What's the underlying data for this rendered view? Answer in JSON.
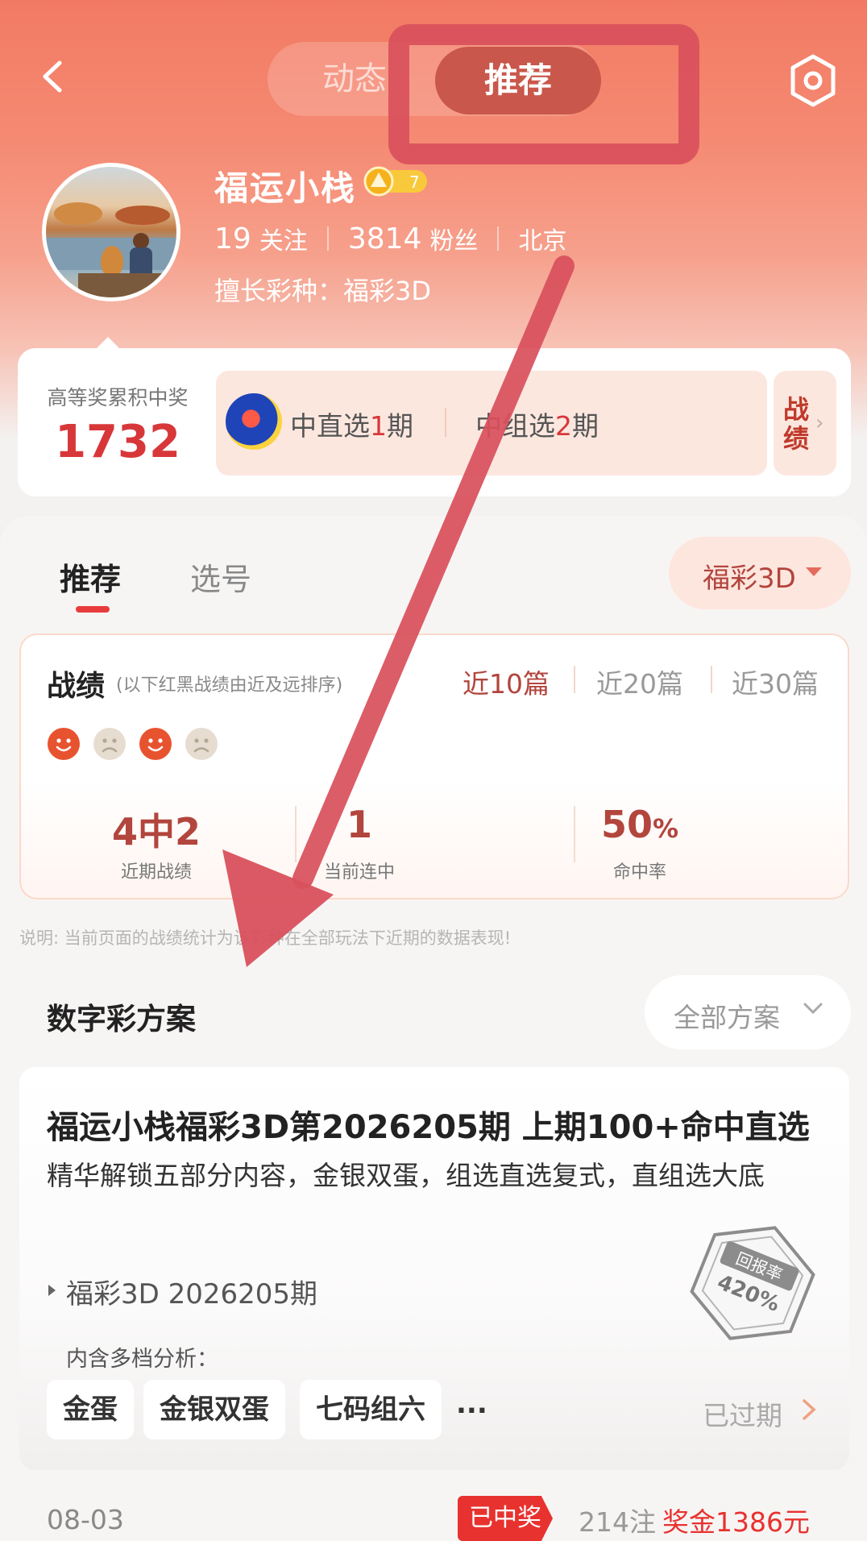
{
  "header": {
    "tabs": [
      {
        "label": "动态",
        "active": false
      },
      {
        "label": "推荐",
        "active": true
      }
    ],
    "icons": {
      "back": "chevron-left-icon",
      "settings": "hexagon-settings-icon"
    }
  },
  "profile": {
    "name": "福运小栈",
    "level": "7",
    "following_count": "19",
    "following_label": "关注",
    "followers_count": "3814",
    "followers_label": "粉丝",
    "location": "北京",
    "specialty": "擅长彩种：福彩3D"
  },
  "achievement": {
    "label": "高等奖累积中奖",
    "value": "1732",
    "hit1_prefix": "中直选",
    "hit1_count": "1",
    "hit1_suffix": "期",
    "hit2_prefix": "中组选",
    "hit2_count": "2",
    "hit2_suffix": "期",
    "record_button": "战绩"
  },
  "content_tabs": [
    {
      "label": "推荐",
      "active": true
    },
    {
      "label": "选号",
      "active": false
    }
  ],
  "lottery_filter": "福彩3D",
  "record": {
    "title": "战绩",
    "note": "(以下红黑战绩由近及远排序)",
    "ranges": [
      "近10篇",
      "近20篇",
      "近30篇"
    ],
    "active_range": "近10篇",
    "results": [
      "win",
      "loss",
      "win",
      "loss"
    ],
    "stats": [
      {
        "value": "4中2",
        "label": "近期战绩"
      },
      {
        "value": "1",
        "label": "当前连中"
      },
      {
        "value": "50",
        "unit": "%",
        "label": "命中率"
      }
    ],
    "colors": {
      "win": "#e8532f",
      "loss": "#e6ddd0"
    }
  },
  "footnote": "说明: 当前页面的战绩统计为该彩种在全部玩法下近期的数据表现!",
  "plans": {
    "title": "数字彩方案",
    "filter": "全部方案"
  },
  "article": {
    "title": "福运小栈福彩3D第2026205期 上期100+命中直选",
    "description": "精华解锁五部分内容，金银双蛋，组选直选复式，直组选大底",
    "issue": "福彩3D 2026205期",
    "stamp_label": "回报率",
    "stamp_value": "420%",
    "multi_label": "内含多档分析：",
    "chips": [
      "金蛋",
      "金银双蛋",
      "七码组六"
    ],
    "chips_more": "...",
    "status": "已过期",
    "date": "08-03",
    "won_tag": "已中奖",
    "bets": "214注",
    "prize_prefix": "奖金",
    "prize_amount": "1386元"
  },
  "colors": {
    "accent_red": "#e8322f",
    "header_gradient_top": "#f27a63",
    "annotation": "#d9505c"
  }
}
